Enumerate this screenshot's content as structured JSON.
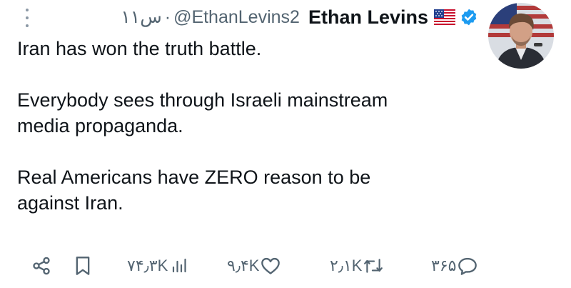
{
  "tweet": {
    "display_name": "Ethan Levins",
    "handle": "@EthanLevins2",
    "time": "۱۱س",
    "separator": "·",
    "body": [
      "Iran has won the truth battle.",
      "Everybody sees through Israeli mainstream",
      "media propaganda.",
      "Real Americans have ZERO reason to be",
      "against Iran."
    ]
  },
  "actions": {
    "views": "۷۴٫۳K",
    "likes": "۹٫۴K",
    "reposts": "۲٫۱K",
    "replies": "۳۶۵"
  },
  "icons": {
    "share": "share-icon",
    "bookmark": "bookmark-icon",
    "views": "views-icon",
    "like": "heart-icon",
    "repost": "repost-icon",
    "reply": "reply-icon",
    "verified": "verified-badge-icon",
    "flag": "us-flag-icon",
    "more": "more-dots-icon"
  },
  "colors": {
    "verified": "#1d9bf0",
    "secondary_text": "#536471",
    "primary_text": "#0f1419"
  }
}
